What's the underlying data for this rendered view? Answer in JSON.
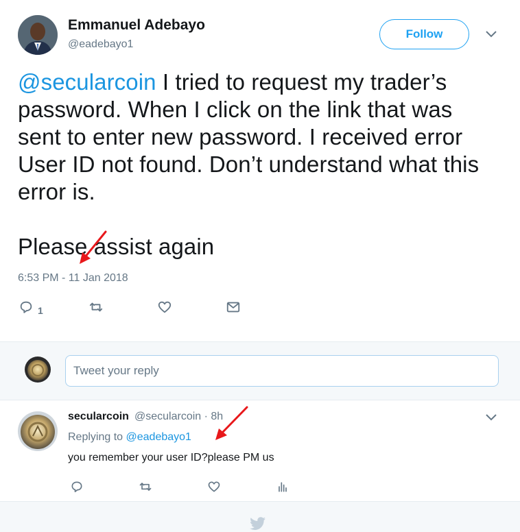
{
  "tweet": {
    "display_name": "Emmanuel Adebayo",
    "handle": "@eadebayo1",
    "follow_label": "Follow",
    "mention": "@secularcoin",
    "text_rest": " I tried to request my trader’s password. When I click on the link that was sent to enter new password. I received error User ID not found. Don’t understand what this error is.",
    "text_para2": "Please assist again",
    "timestamp": "6:53 PM - 11 Jan 2018",
    "actions": {
      "reply_count": "1",
      "reply_icon": "reply-icon",
      "retweet_icon": "retweet-icon",
      "like_icon": "heart-icon",
      "dm_icon": "envelope-icon"
    }
  },
  "reply_box": {
    "placeholder": "Tweet your reply"
  },
  "reply": {
    "name": "secularcoin",
    "meta": "@secularcoin · 8h",
    "replying_prefix": "Replying to ",
    "replying_to": "@eadebayo1",
    "text": "you remember your user ID?please PM us",
    "icons": [
      "reply-icon",
      "retweet-icon",
      "heart-icon",
      "analytics-icon"
    ]
  },
  "colors": {
    "accent": "#1da1f2",
    "link": "#1b95e0",
    "muted": "#657786",
    "annotation_arrow": "#e8181b"
  }
}
